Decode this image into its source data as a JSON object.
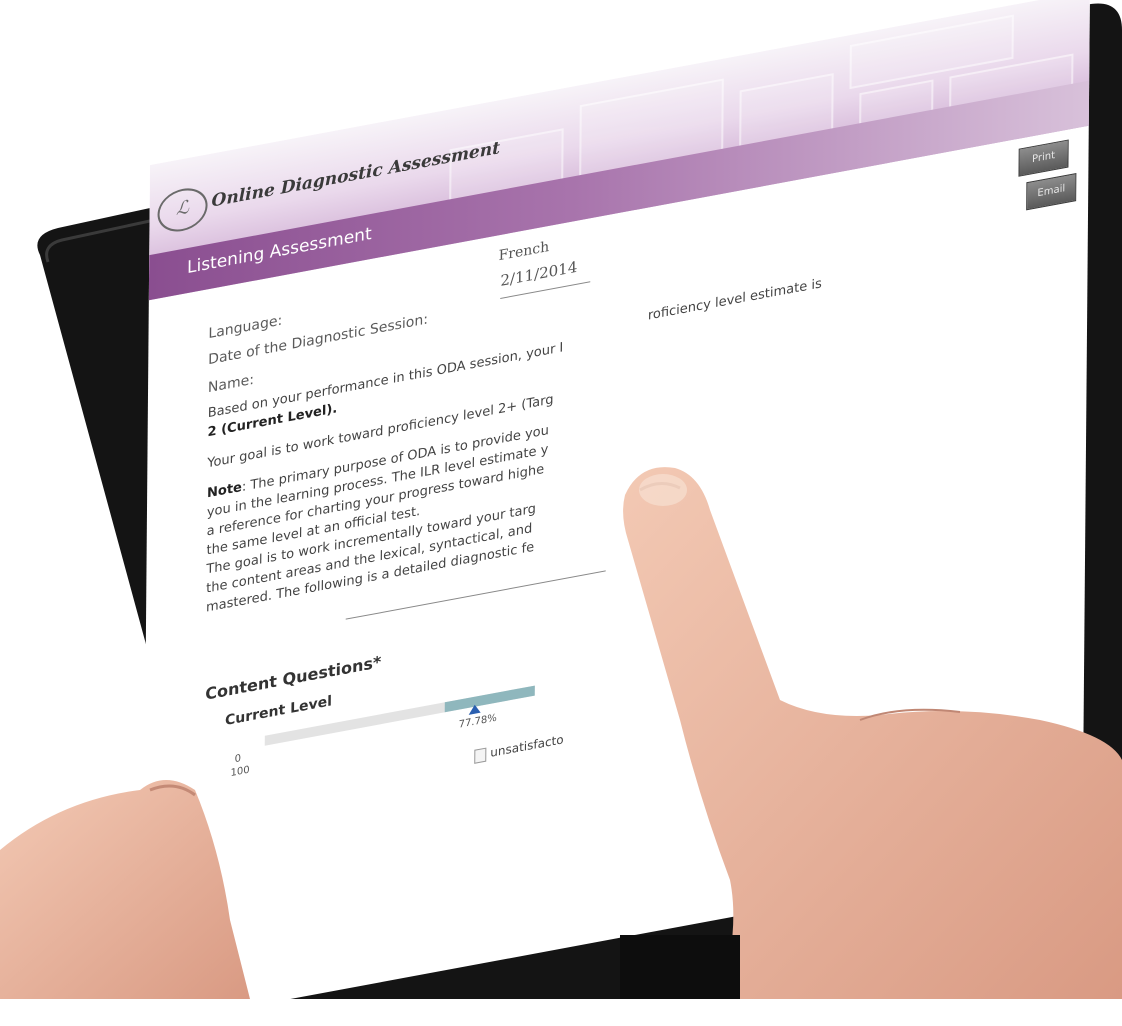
{
  "app": {
    "logo_mark": "ℒ",
    "logo_text": "Online Diagnostic Assessment",
    "print_label": "Print",
    "email_label": "Email"
  },
  "section": {
    "title": "Listening Assessment"
  },
  "fields": {
    "language_label": "Language:",
    "language_value": "French",
    "date_label": "Date of the Diagnostic Session:",
    "date_value": "2/11/2014",
    "name_label": "Name:",
    "name_value": ""
  },
  "text": {
    "result_line1": "Based on your performance in this ODA session, your I",
    "result_tail": "roficiency level estimate is",
    "result_line2": "2 (Current Level).",
    "goal_line": "Your goal is to work toward proficiency level 2+ (Targ",
    "note_label": "Note",
    "note_lines": [
      ": The primary purpose of ODA is to provide you",
      "you in the learning process. The ILR level estimate y",
      "a reference for charting your progress toward highe",
      "the same level at an official test.",
      "The goal is to work incrementally toward your targ",
      "the content areas and the lexical, syntactical, and",
      "mastered. The following is a detailed diagnostic fe"
    ]
  },
  "results": {
    "heading": "Content Questions*",
    "current_level_label": "Current Level",
    "scale_min": "0",
    "scale_max": "100",
    "score_label": "77.78%",
    "score_value": 77.78,
    "legend_label": "unsatisfacto"
  },
  "colors": {
    "header_purple": "#8a4e90",
    "bar_fill": "#8fb7bd",
    "marker_blue": "#2a5fb0"
  }
}
